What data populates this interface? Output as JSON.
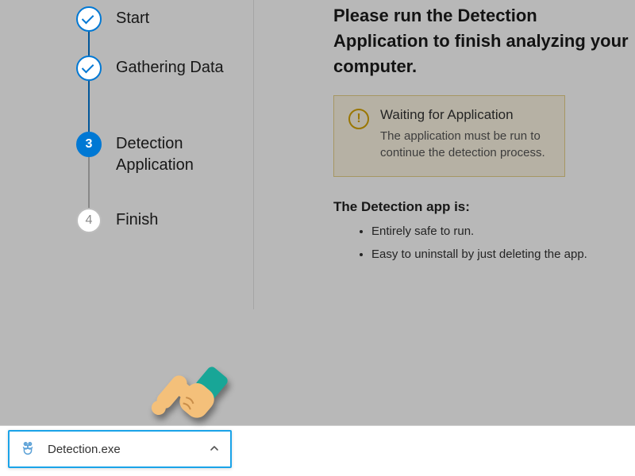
{
  "steps": [
    {
      "label": "Start",
      "state": "done"
    },
    {
      "label": "Gathering Data",
      "state": "done"
    },
    {
      "num": "3",
      "label": "Detection Application",
      "state": "active"
    },
    {
      "num": "4",
      "label": "Finish",
      "state": "future"
    }
  ],
  "main": {
    "instruction": "Please run the Detection Application to finish analyzing your computer."
  },
  "alert": {
    "icon_glyph": "!",
    "title": "Waiting for Application",
    "body": "The application must be run to continue the detection process."
  },
  "info": {
    "heading": "The Detection app is:",
    "bullet1": "Entirely safe to run.",
    "bullet2": "Easy to uninstall by just deleting the app."
  },
  "download": {
    "filename": "Detection.exe"
  }
}
